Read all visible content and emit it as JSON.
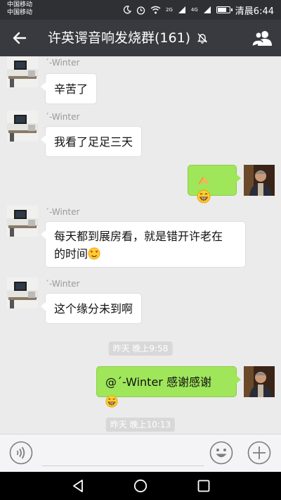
{
  "status_bar": {
    "carrier_1": "中国移动",
    "carrier_2": "中国移动",
    "network_1": "2G",
    "network_2": "4G",
    "clock": "清晨6:44"
  },
  "header": {
    "title": "许英谔音响发烧群(161)",
    "muted": true,
    "icons": [
      "back-arrow-icon",
      "mute-bell-icon",
      "group-members-icon"
    ]
  },
  "messages": [
    {
      "side": "left",
      "sender": "ˊ-Winter",
      "text": "辛苦了"
    },
    {
      "side": "left",
      "sender": "ˊ-Winter",
      "text": "我看了足足三天"
    },
    {
      "side": "right",
      "text": "",
      "emojis": [
        "clasped-hands",
        "grinning"
      ]
    },
    {
      "side": "left",
      "sender": "ˊ-Winter",
      "line1": "每天都到展房看，就是错开许老在",
      "line2": "的时间",
      "emojis": [
        "heart-eyes"
      ]
    },
    {
      "side": "left",
      "sender": "ˊ-Winter",
      "text": "这个缘分未到啊"
    },
    {
      "type": "time",
      "text": "昨天 晚上9:58"
    },
    {
      "side": "right",
      "text": "@ˊ-Winter 感谢感谢",
      "emojis": [
        "grinning"
      ]
    },
    {
      "type": "time",
      "text": "昨天 晚上10:13"
    }
  ],
  "input_bar": {
    "icons": [
      "voice-icon",
      "emoji-icon",
      "plus-icon"
    ]
  },
  "nav_bar": {
    "icons": [
      "back-triangle-icon",
      "home-circle-icon",
      "recent-square-icon"
    ]
  },
  "colors": {
    "title_bar": "#393a3f",
    "status_bar": "#2f3033",
    "chat_bg": "#ebebeb",
    "bubble_self": "#9fe65a",
    "bubble_other": "#ffffff"
  }
}
